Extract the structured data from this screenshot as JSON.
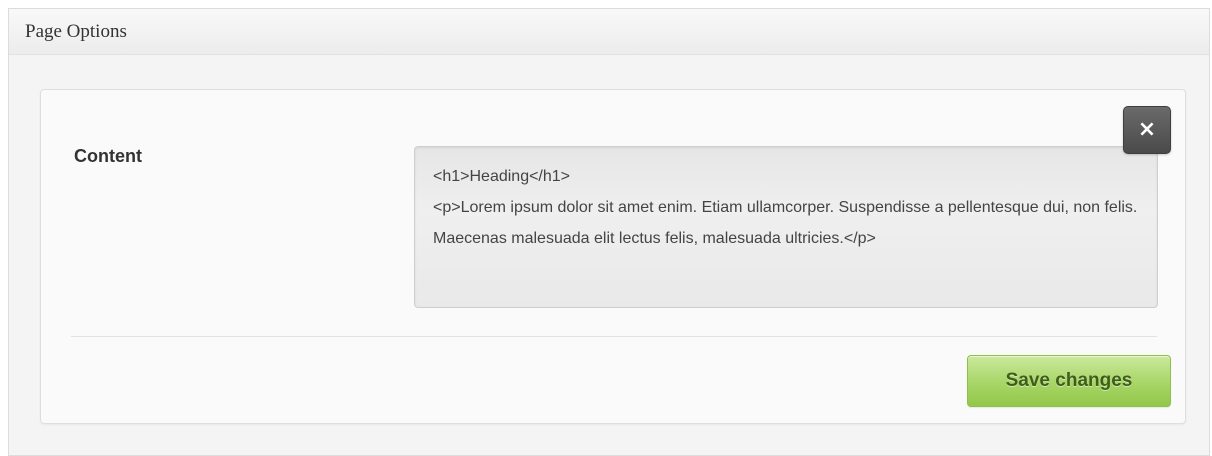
{
  "panel": {
    "title": "Page Options"
  },
  "form": {
    "content_label": "Content",
    "content_value": "<h1>Heading</h1>\n<p>Lorem ipsum dolor sit amet enim. Etiam ullamcorper. Suspendisse a pellentesque dui, non felis. Maecenas malesuada elit lectus felis, malesuada ultricies.</p>",
    "close_label": "×",
    "close_icon": "close-icon",
    "save_label": "Save changes"
  },
  "colors": {
    "save_button": "#a7d566",
    "close_button": "#4a4a4a"
  }
}
